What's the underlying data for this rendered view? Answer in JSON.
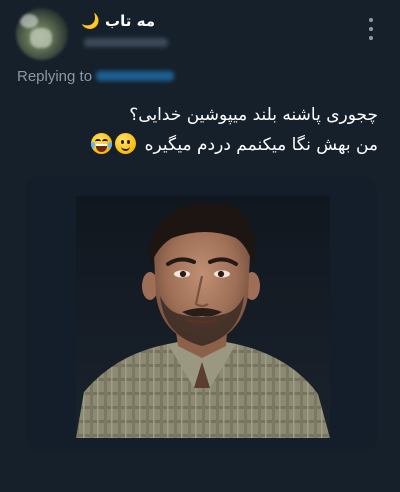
{
  "tweet": {
    "author": {
      "display_name": "مه تاب",
      "name_emoji": "🌙"
    },
    "replying_to_label": "Replying to",
    "text_lines": [
      "چجوری پاشنه بلند میپوشین خدایی؟",
      "من بهش نگا میکنمم دردم میگیره"
    ],
    "emojis": [
      "slightly-smiling-face",
      "grinning-squinting-face"
    ],
    "media": {
      "kind": "photo"
    }
  },
  "colors": {
    "background": "#15202b",
    "text": "#ffffff",
    "secondary_text": "#8b98a5",
    "mention": "#1d9bf0"
  },
  "icons": {
    "menu": "more-vertical-icon",
    "name_badge": "crescent-moon-icon"
  }
}
